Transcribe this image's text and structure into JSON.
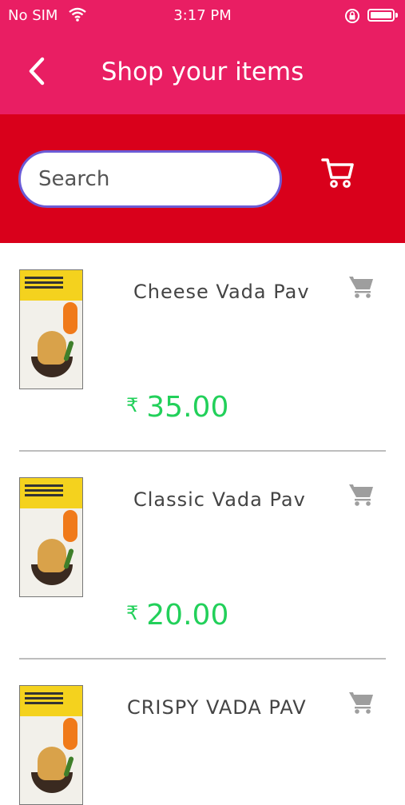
{
  "status": {
    "carrier": "No SIM",
    "time": "3:17 PM"
  },
  "header": {
    "title": "Shop your items"
  },
  "search": {
    "placeholder": "Search"
  },
  "currency": "₹",
  "items": [
    {
      "name": "Cheese Vada Pav",
      "price": "35.00"
    },
    {
      "name": "Classic Vada Pav",
      "price": "20.00"
    },
    {
      "name": "CRISPY VADA PAV",
      "price": ""
    }
  ],
  "colors": {
    "header": "#e91e63",
    "search_band": "#d9001b",
    "price": "#22d05a"
  }
}
